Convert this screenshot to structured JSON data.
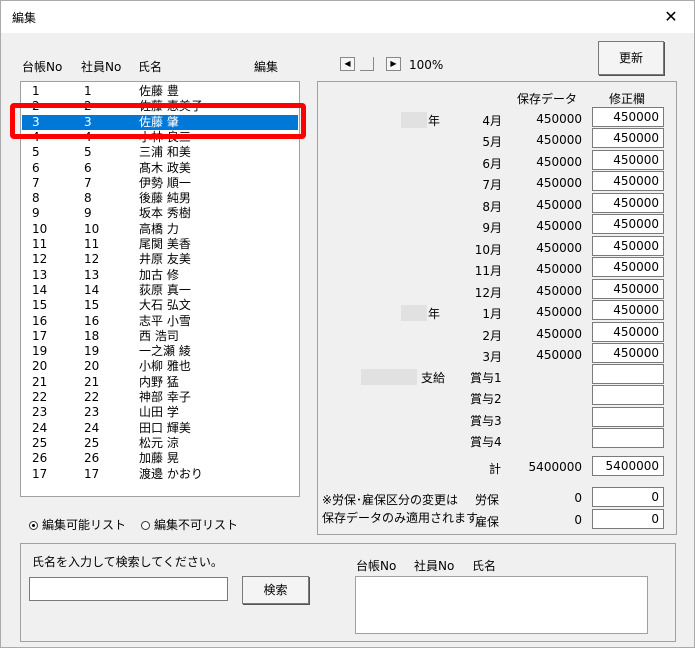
{
  "window": {
    "title": "編集",
    "close_glyph": "✕"
  },
  "list_header": {
    "ledger_no": "台帳No",
    "employee_no": "社員No",
    "name": "氏名",
    "edit": "編集"
  },
  "list_items": [
    {
      "a": "1",
      "b": "1",
      "n": "佐藤 豊"
    },
    {
      "a": "2",
      "b": "2",
      "n": "佐藤 恵美子"
    },
    {
      "a": "3",
      "b": "3",
      "n": "佐藤 肇"
    },
    {
      "a": "4",
      "b": "4",
      "n": "小林 良三"
    },
    {
      "a": "5",
      "b": "5",
      "n": "三浦 和美"
    },
    {
      "a": "6",
      "b": "6",
      "n": "髙木 政美"
    },
    {
      "a": "7",
      "b": "7",
      "n": "伊勢 順一"
    },
    {
      "a": "8",
      "b": "8",
      "n": "後藤 純男"
    },
    {
      "a": "9",
      "b": "9",
      "n": "坂本 秀樹"
    },
    {
      "a": "10",
      "b": "10",
      "n": "高橋 力"
    },
    {
      "a": "11",
      "b": "11",
      "n": "尾関 美香"
    },
    {
      "a": "12",
      "b": "12",
      "n": "井原 友美"
    },
    {
      "a": "13",
      "b": "13",
      "n": "加古 修"
    },
    {
      "a": "14",
      "b": "14",
      "n": "荻原 真一"
    },
    {
      "a": "15",
      "b": "15",
      "n": "大石 弘文"
    },
    {
      "a": "16",
      "b": "16",
      "n": "志平 小雪"
    },
    {
      "a": "17",
      "b": "18",
      "n": "西 浩司"
    },
    {
      "a": "19",
      "b": "19",
      "n": "一之瀬 綾"
    },
    {
      "a": "20",
      "b": "20",
      "n": "小柳 雅也"
    },
    {
      "a": "21",
      "b": "21",
      "n": "内野 猛"
    },
    {
      "a": "22",
      "b": "22",
      "n": "神部 幸子"
    },
    {
      "a": "23",
      "b": "23",
      "n": "山田 学"
    },
    {
      "a": "24",
      "b": "24",
      "n": "田口 輝美"
    },
    {
      "a": "25",
      "b": "25",
      "n": "松元 涼"
    },
    {
      "a": "26",
      "b": "26",
      "n": "加藤 晃"
    },
    {
      "a": "17",
      "b": "17",
      "n": "渡邊 かおり"
    }
  ],
  "selected_index": 2,
  "zoom": {
    "left_arrow": "◀",
    "right_arrow": "▶",
    "value": "100%"
  },
  "update_button": "更新",
  "data_header": {
    "saved": "保存データ",
    "modify": "修正欄"
  },
  "year_label": "年",
  "months": [
    {
      "m": "4月",
      "saved": "450000",
      "mod": "450000"
    },
    {
      "m": "5月",
      "saved": "450000",
      "mod": "450000"
    },
    {
      "m": "6月",
      "saved": "450000",
      "mod": "450000"
    },
    {
      "m": "7月",
      "saved": "450000",
      "mod": "450000"
    },
    {
      "m": "8月",
      "saved": "450000",
      "mod": "450000"
    },
    {
      "m": "9月",
      "saved": "450000",
      "mod": "450000"
    },
    {
      "m": "10月",
      "saved": "450000",
      "mod": "450000"
    },
    {
      "m": "11月",
      "saved": "450000",
      "mod": "450000"
    },
    {
      "m": "12月",
      "saved": "450000",
      "mod": "450000"
    },
    {
      "m": "1月",
      "saved": "450000",
      "mod": "450000"
    },
    {
      "m": "2月",
      "saved": "450000",
      "mod": "450000"
    },
    {
      "m": "3月",
      "saved": "450000",
      "mod": "450000"
    }
  ],
  "bonus_label": "支給",
  "bonuses": [
    "賞与1",
    "賞与2",
    "賞与3",
    "賞与4"
  ],
  "total": {
    "label": "計",
    "saved": "5400000",
    "mod": "5400000"
  },
  "note_lines": [
    "※労保･雇保区分の変更は",
    "保存データのみ適用されます"
  ],
  "insurance": [
    {
      "label": "労保",
      "saved": "0",
      "mod": "0"
    },
    {
      "label": "雇保",
      "saved": "0",
      "mod": "0"
    }
  ],
  "radios": {
    "editable": "編集可能リスト",
    "not_editable": "編集不可リスト"
  },
  "search": {
    "prompt": "氏名を入力して検索してください。",
    "button": "検索",
    "result_ledger": "台帳No",
    "result_employee": "社員No",
    "result_name": "氏名"
  }
}
